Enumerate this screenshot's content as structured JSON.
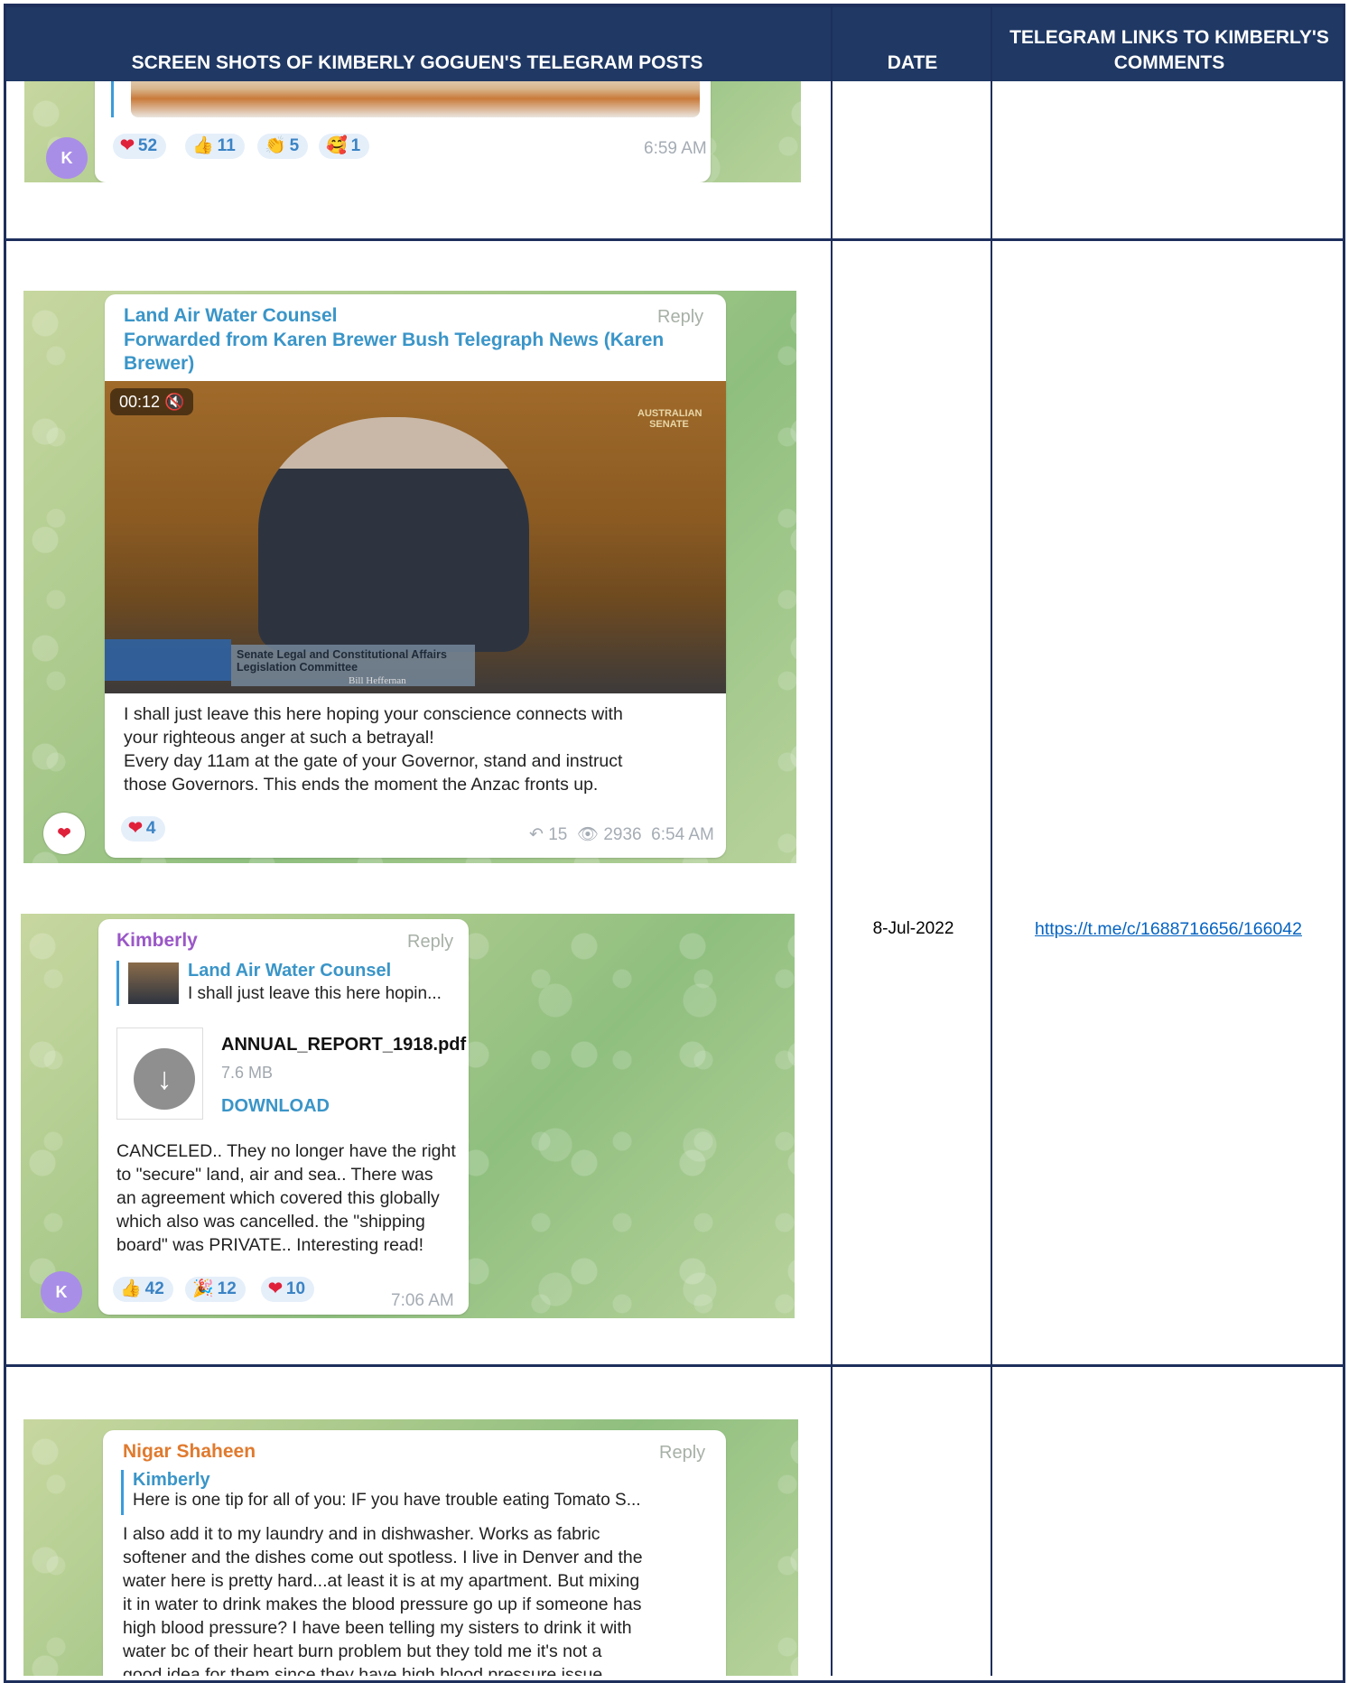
{
  "header": {
    "col_screenshots": "SCREEN SHOTS OF KIMBERLY GOGUEN'S TELEGRAM POSTS",
    "col_date": "DATE",
    "col_links": "TELEGRAM LINKS TO KIMBERLY'S COMMENTS"
  },
  "row1": {
    "avatar_letter": "K",
    "reactions": [
      {
        "icon": "heart-icon",
        "emoji": "❤",
        "count": "52"
      },
      {
        "icon": "thumbs-up-icon",
        "emoji": "👍",
        "count": "11"
      },
      {
        "icon": "clap-icon",
        "emoji": "👏",
        "count": "5"
      },
      {
        "icon": "party-icon",
        "emoji": "🥰",
        "count": "1"
      }
    ],
    "time": "6:59 AM"
  },
  "row2": {
    "date": "8-Jul-2022",
    "link": "https://t.me/c/1688716656/166042",
    "post1": {
      "sender": "Land Air Water Counsel",
      "reply": "Reply",
      "forwarded": "Forwarded from Karen Brewer Bush Telegraph News (Karen Brewer)",
      "video_duration": "00:12",
      "video_senate_logo": "AUSTRALIAN SENATE",
      "video_caption_line1": "Senate Legal and Constitutional Affairs",
      "video_caption_line2": "Legislation Committee",
      "video_name": "Bill Heffernan",
      "body": "I shall just leave this here hoping your conscience connects with\nyour righteous anger at such a betrayal!\nEvery day 11am at the gate of your Governor, stand and instruct\nthose Governors. This ends the moment the Anzac fronts up.",
      "reaction_count": "4",
      "shares": "15",
      "views": "2936",
      "time": "6:54 AM"
    },
    "post2": {
      "sender": "Kimberly",
      "reply": "Reply",
      "quote_name": "Land Air Water Counsel",
      "quote_text": "I shall just leave this here hopin...",
      "file_name": "ANNUAL_REPORT_1918.pdf",
      "file_size": "7.6 MB",
      "download": "DOWNLOAD",
      "body": "CANCELED.. They no longer have the right\nto \"secure\" land, air and sea.. There was\nan agreement which covered this globally\nwhich also was cancelled. the \"shipping\nboard\" was PRIVATE.. Interesting read!",
      "avatar_letter": "K",
      "reactions": [
        {
          "icon": "thumbs-up-icon",
          "emoji": "👍",
          "count": "42"
        },
        {
          "icon": "party-popper-icon",
          "emoji": "🎉",
          "count": "12"
        },
        {
          "icon": "heart-icon",
          "emoji": "❤",
          "count": "10"
        }
      ],
      "time": "7:06 AM"
    }
  },
  "row3": {
    "sender": "Nigar Shaheen",
    "reply": "Reply",
    "quote_name": "Kimberly",
    "quote_text": "Here is one tip for all of you: IF you have trouble eating Tomato S...",
    "body": "I also add it to my laundry and in dishwasher. Works as fabric\nsoftener and the dishes come out spotless. I live in Denver and the\nwater here is pretty hard...at least it is at my apartment. But mixing\nit in water to drink makes the blood pressure go up if someone has\nhigh blood pressure? I have been telling my sisters to drink it with\nwater bc of their heart burn problem but they told me it's not a\ngood idea for them since they have high blood pressure issue."
  }
}
